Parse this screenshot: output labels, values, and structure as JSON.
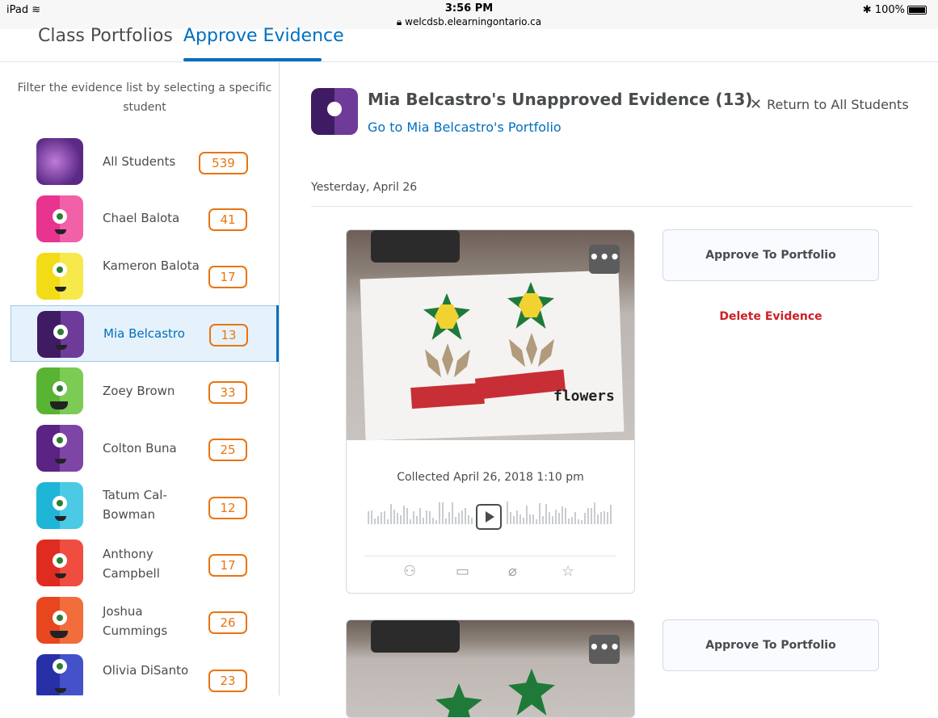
{
  "status_bar": {
    "device": "iPad",
    "time": "3:56 PM",
    "url": "welcdsb.elearningontario.ca",
    "battery": "100%"
  },
  "tabs": [
    {
      "label": "Class Portfolios"
    },
    {
      "label": "Approve Evidence"
    }
  ],
  "sidebar": {
    "filter_text": "Filter the evidence list by selecting a specific student",
    "students": [
      {
        "name": "All Students",
        "count": "539"
      },
      {
        "name": "Chael Balota",
        "count": "41"
      },
      {
        "name": "Kameron Balota",
        "count": "17"
      },
      {
        "name": "Mia Belcastro",
        "count": "13"
      },
      {
        "name": "Zoey Brown",
        "count": "33"
      },
      {
        "name": "Colton Buna",
        "count": "25"
      },
      {
        "name": "Tatum Cal-Bowman",
        "count": "12"
      },
      {
        "name": "Anthony Campbell",
        "count": "17"
      },
      {
        "name": "Joshua Cummings",
        "count": "26"
      },
      {
        "name": "Olivia DiSanto",
        "count": "23"
      }
    ]
  },
  "main": {
    "title": "Mia Belcastro's Unapproved Evidence (13)",
    "portfolio_link": "Go to Mia Belcastro's Portfolio",
    "return_label": "Return to All Students",
    "date_label": "Yesterday, April 26",
    "cards": [
      {
        "photo_caption": "flowers",
        "collected": "Collected April 26, 2018 1:10 pm",
        "approve_label": "Approve To Portfolio",
        "delete_label": "Delete Evidence",
        "more_label": "•••"
      },
      {
        "approve_label": "Approve To Portfolio",
        "more_label": "•••"
      }
    ]
  },
  "colors": {
    "accent": "#006fbf",
    "badge": "#e87511",
    "danger": "#cd2026"
  }
}
